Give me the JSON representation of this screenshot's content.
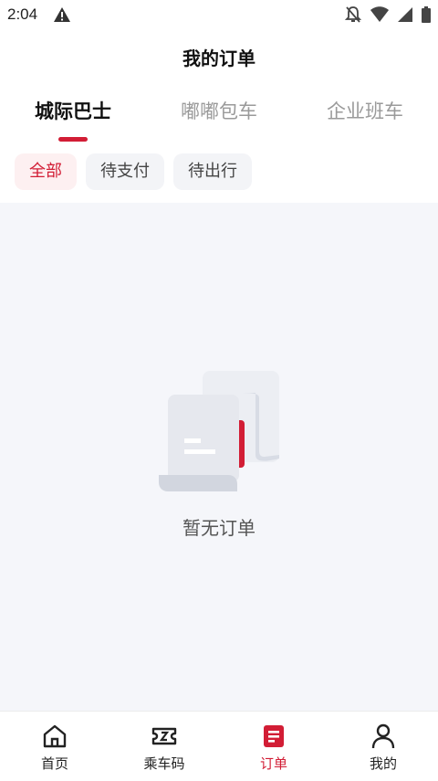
{
  "status_bar": {
    "time": "2:04"
  },
  "header": {
    "title": "我的订单"
  },
  "top_tabs": [
    {
      "label": "城际巴士",
      "active": true
    },
    {
      "label": "嘟嘟包车",
      "active": false
    },
    {
      "label": "企业班车",
      "active": false
    }
  ],
  "filters": [
    {
      "label": "全部",
      "active": true
    },
    {
      "label": "待支付",
      "active": false
    },
    {
      "label": "待出行",
      "active": false
    }
  ],
  "empty_state": {
    "message": "暂无订单",
    "icon": "empty-document-icon"
  },
  "bottom_nav": [
    {
      "label": "首页",
      "icon": "home-icon",
      "active": false
    },
    {
      "label": "乘车码",
      "icon": "ticket-icon",
      "active": false
    },
    {
      "label": "订单",
      "icon": "order-icon",
      "active": true
    },
    {
      "label": "我的",
      "icon": "profile-icon",
      "active": false
    }
  ],
  "colors": {
    "accent": "#d21d35",
    "background": "#f5f6fa",
    "chip_bg": "#f3f4f7"
  }
}
